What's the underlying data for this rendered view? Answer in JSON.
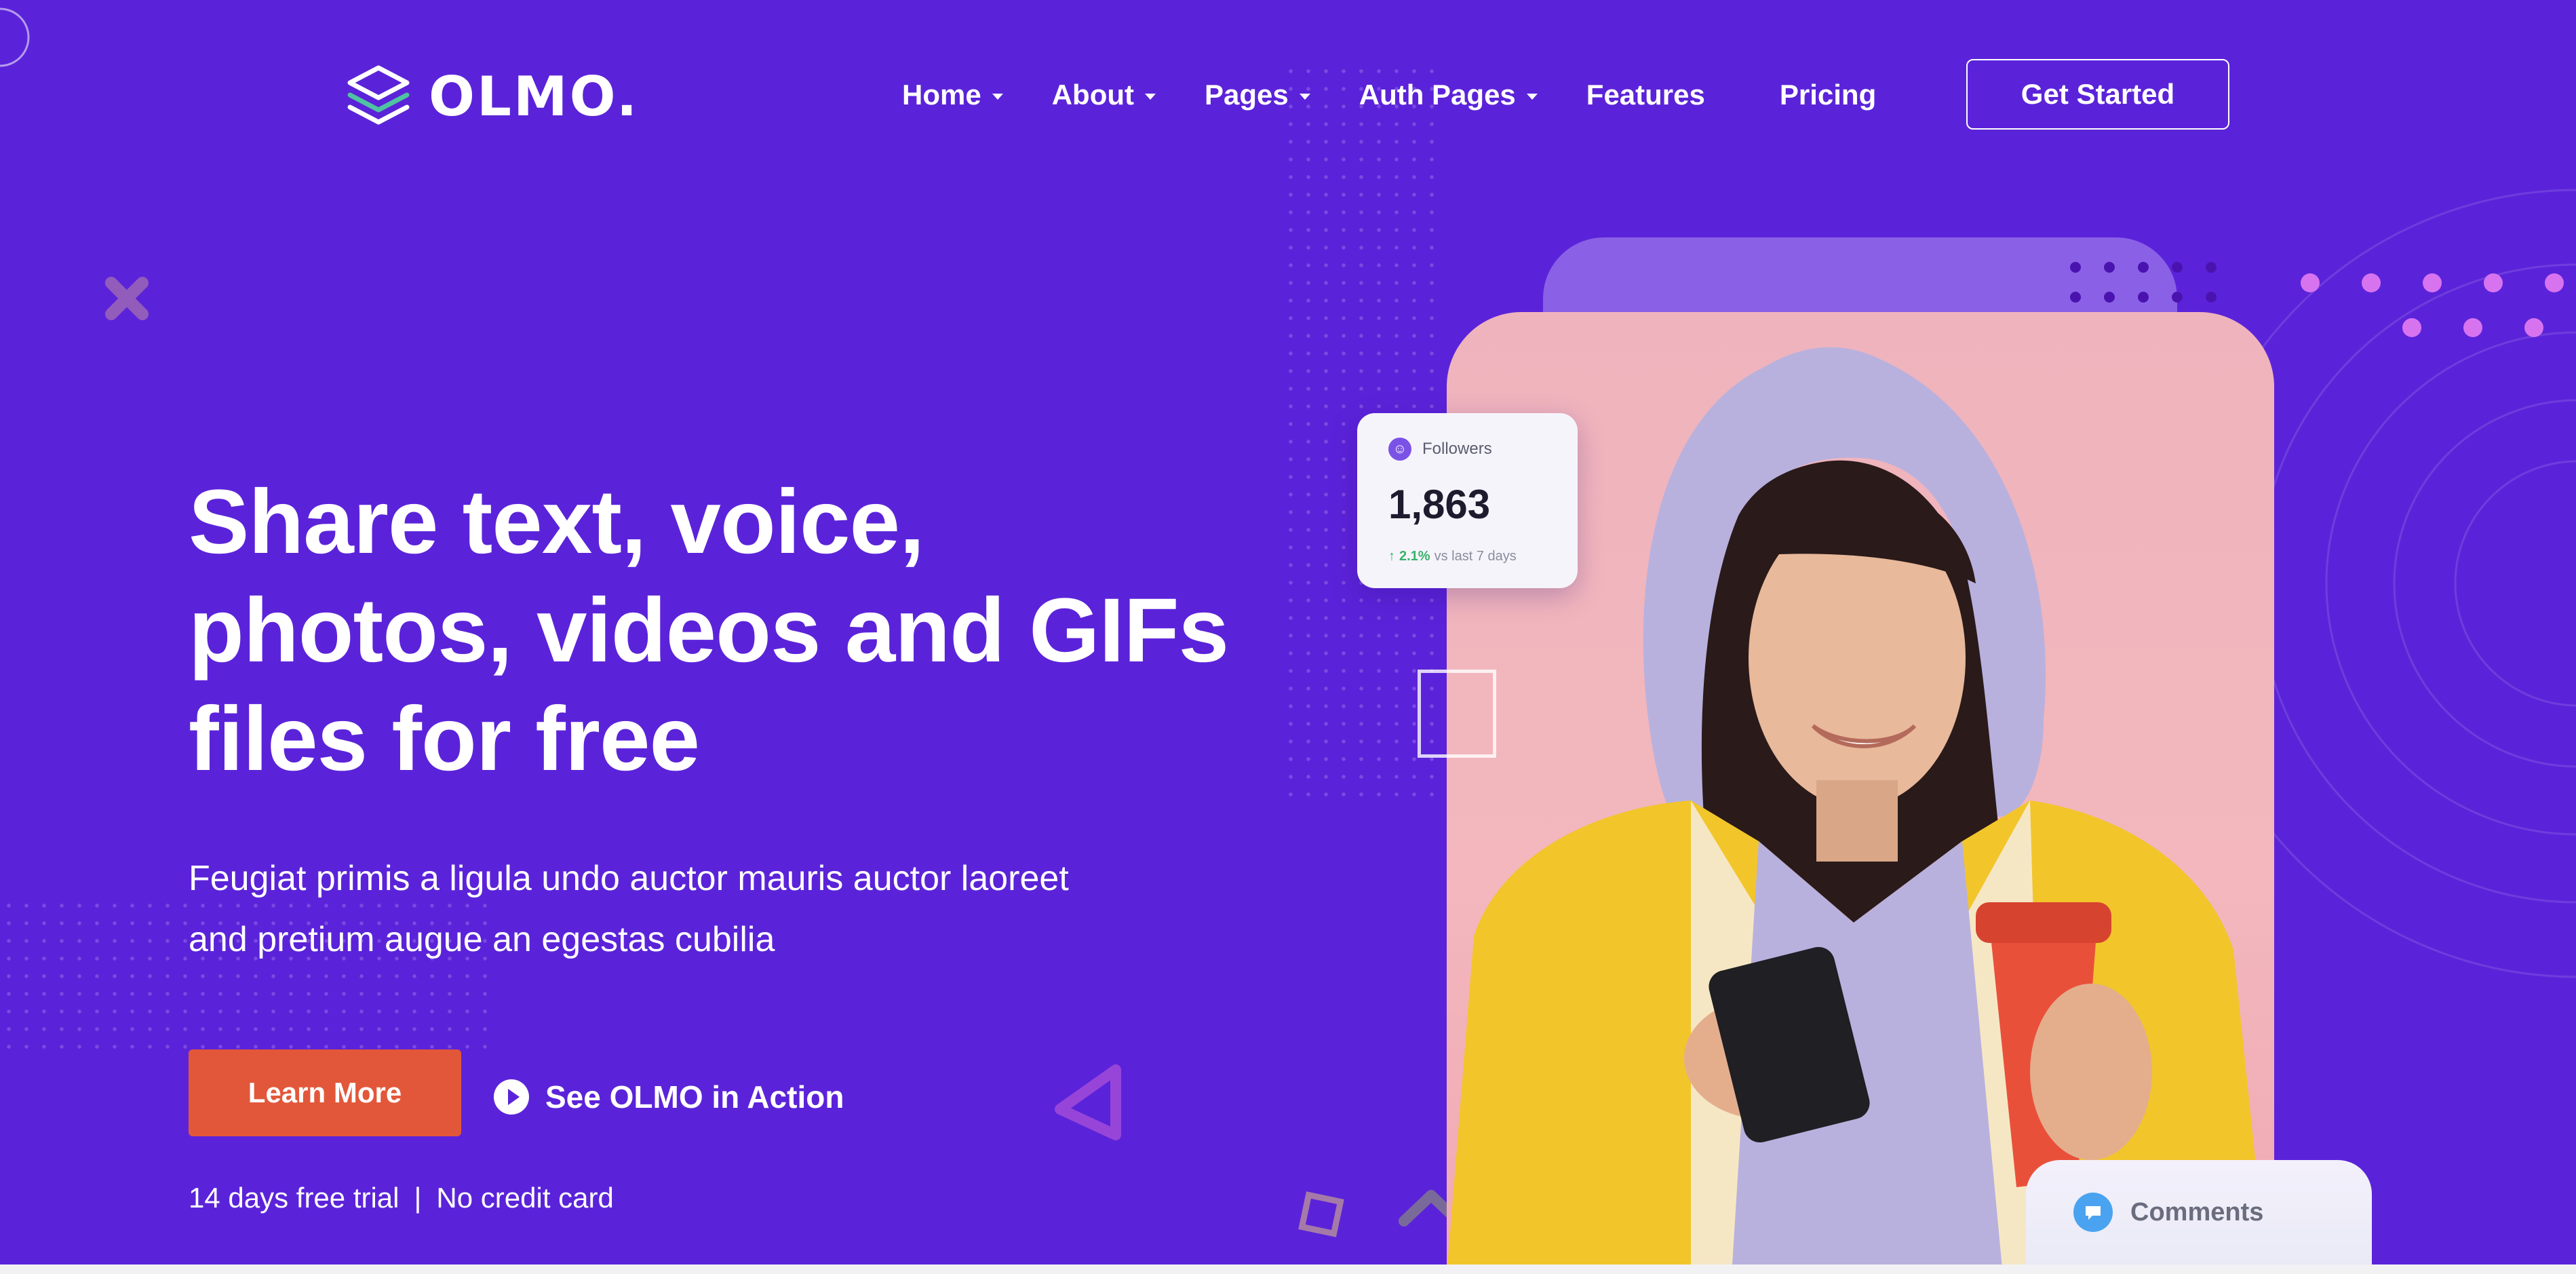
{
  "brand": {
    "name": "OLMO.",
    "logo_icon": "layers-icon"
  },
  "nav": {
    "items": [
      {
        "label": "Home",
        "has_dropdown": true
      },
      {
        "label": "About",
        "has_dropdown": true
      },
      {
        "label": "Pages",
        "has_dropdown": true
      },
      {
        "label": "Auth Pages",
        "has_dropdown": true
      },
      {
        "label": "Features",
        "has_dropdown": false
      },
      {
        "label": "Pricing",
        "has_dropdown": false
      }
    ],
    "cta_label": "Get Started"
  },
  "hero": {
    "title_line1": "Share text, voice,",
    "title_line2": "photos, videos and GIFs",
    "title_line3": "files for free",
    "subtitle_line1": "Feugiat primis a ligula undo auctor mauris auctor laoreet",
    "subtitle_line2": "and pretium augue an egestas cubilia",
    "primary_button": "Learn More",
    "video_button": "See OLMO in Action",
    "trial_text": "14 days free trial",
    "separator": "|",
    "no_card_text": "No credit card"
  },
  "followers_card": {
    "label": "Followers",
    "value": "1,863",
    "change": "2.1%",
    "period": "vs last 7 days"
  },
  "comments_card": {
    "label": "Comments"
  },
  "colors": {
    "background": "#5b23d9",
    "primary_button": "#e2573a",
    "photo_backdrop": "#efb3bd",
    "accent_dots": "#d873f0",
    "trend_up": "#38b26a"
  }
}
